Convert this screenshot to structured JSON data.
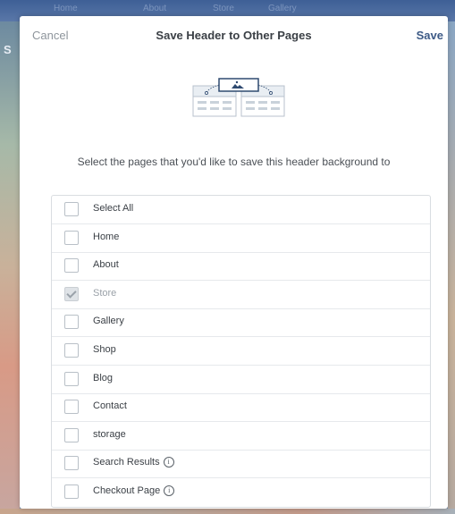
{
  "background": {
    "side_letter": "S",
    "top_nav": [
      "Home",
      "About",
      "Store",
      "Gallery"
    ]
  },
  "modal": {
    "cancel_label": "Cancel",
    "title": "Save Header to Other Pages",
    "save_label": "Save",
    "instruction": "Select the pages that you'd like to save this header background to",
    "pages": [
      {
        "label": "Select All",
        "checked": false,
        "disabled": false,
        "info": false
      },
      {
        "label": "Home",
        "checked": false,
        "disabled": false,
        "info": false
      },
      {
        "label": "About",
        "checked": false,
        "disabled": false,
        "info": false
      },
      {
        "label": "Store",
        "checked": true,
        "disabled": true,
        "info": false
      },
      {
        "label": "Gallery",
        "checked": false,
        "disabled": false,
        "info": false
      },
      {
        "label": "Shop",
        "checked": false,
        "disabled": false,
        "info": false
      },
      {
        "label": "Blog",
        "checked": false,
        "disabled": false,
        "info": false
      },
      {
        "label": "Contact",
        "checked": false,
        "disabled": false,
        "info": false
      },
      {
        "label": "storage",
        "checked": false,
        "disabled": false,
        "info": false
      },
      {
        "label": "Search Results",
        "checked": false,
        "disabled": false,
        "info": true
      },
      {
        "label": "Checkout Page",
        "checked": false,
        "disabled": false,
        "info": true
      }
    ],
    "info_icon_glyph": "i"
  },
  "colors": {
    "accent": "#3d5a86",
    "muted_text": "#8e959c",
    "border": "#d9dde1"
  }
}
